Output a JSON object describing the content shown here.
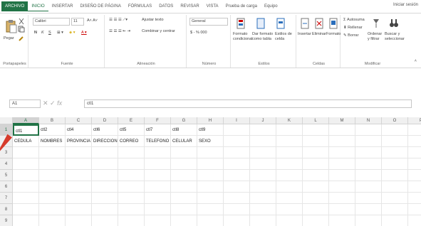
{
  "ribbon_tabs": [
    "ARCHIVO",
    "INICIO",
    "INSERTAR",
    "DISEÑO DE PÁGINA",
    "FÓRMULAS",
    "DATOS",
    "REVISAR",
    "VISTA",
    "Prueba de carga",
    "Equipo"
  ],
  "signin": "Iniciar sesión",
  "clipboard": {
    "paste": "Pegar",
    "label": "Portapapeles"
  },
  "font": {
    "name": "Calibri",
    "size": "11",
    "label": "Fuente",
    "bold": "N",
    "italic": "K",
    "underline": "S"
  },
  "alignment": {
    "wrap": "Ajustar texto",
    "merge": "Combinar y centrar",
    "label": "Alineación"
  },
  "number": {
    "format": "General",
    "label": "Número",
    "currency": "$ - % 000"
  },
  "styles": {
    "conditional": "Formato condicional",
    "table": "Dar formato como tabla",
    "cell_styles": "Estilos de celda",
    "label": "Estilos"
  },
  "cells": {
    "insert": "Insertar",
    "delete": "Eliminar",
    "format": "Formato",
    "label": "Celdas"
  },
  "editing": {
    "autosum": "Autosuma",
    "fill": "Rellenar",
    "clear": "Borrar",
    "sort": "Ordenar y filtrar",
    "find": "Buscar y seleccionar",
    "label": "Modificar"
  },
  "formula_bar": {
    "name_box": "A1",
    "value": "ctl1"
  },
  "columns": [
    "A",
    "B",
    "C",
    "D",
    "E",
    "F",
    "G",
    "H",
    "I",
    "J",
    "K",
    "L",
    "M",
    "N",
    "O",
    "P"
  ],
  "rows": [
    {
      "num": "1",
      "cells": [
        "ctl1",
        "ctl2",
        "ctl4",
        "ctl6",
        "ctl5",
        "ctl7",
        "ctl8",
        "ctl9"
      ]
    },
    {
      "num": "2",
      "cells": [
        "CEDULA",
        "NOMBRES",
        "PROVINCIA",
        "DIRECCION",
        "CORREO",
        "TELEFONO",
        "CELULAR",
        "SEXO"
      ]
    },
    {
      "num": "3",
      "cells": []
    },
    {
      "num": "4",
      "cells": []
    },
    {
      "num": "5",
      "cells": []
    },
    {
      "num": "6",
      "cells": []
    },
    {
      "num": "7",
      "cells": []
    },
    {
      "num": "8",
      "cells": []
    },
    {
      "num": "9",
      "cells": []
    }
  ],
  "colors": {
    "accent": "#217346",
    "annotation_arrow": "#d63b2c"
  }
}
